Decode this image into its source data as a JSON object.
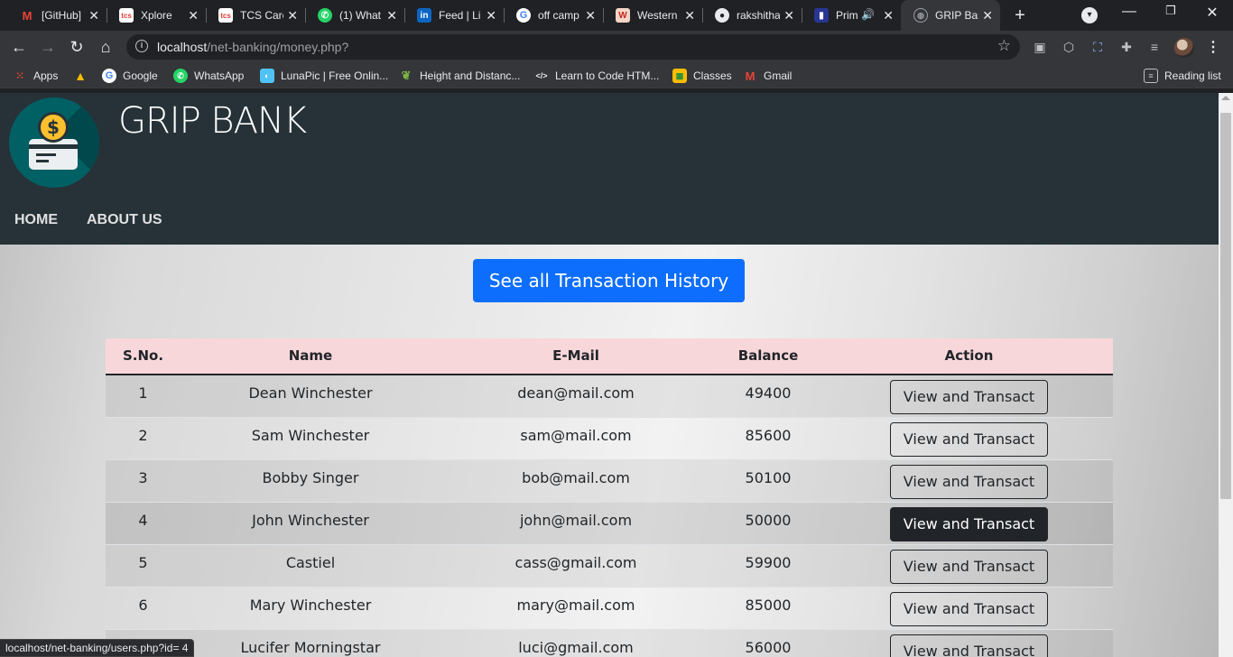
{
  "browser": {
    "tabs": [
      {
        "title": "[GitHub]",
        "icon": "gmail-icon",
        "color": "#ea4335"
      },
      {
        "title": "Xplore",
        "icon": "tcs-icon",
        "color": "#e53935"
      },
      {
        "title": "TCS Care",
        "icon": "tcs-icon",
        "color": "#e53935"
      },
      {
        "title": "(1) What",
        "icon": "whatsapp-icon",
        "color": "#25d366"
      },
      {
        "title": "Feed | Li",
        "icon": "linkedin-icon",
        "color": "#0a66c2"
      },
      {
        "title": "off camp",
        "icon": "google-icon",
        "color": "#4285f4"
      },
      {
        "title": "Western",
        "icon": "western-icon",
        "color": "#c62828"
      },
      {
        "title": "rakshitha",
        "icon": "github-icon",
        "color": "#e8eaed"
      },
      {
        "title": "Prim",
        "icon": "prime-icon",
        "color": "#283593"
      },
      {
        "title": "GRIP Ban",
        "icon": "globe-icon",
        "color": "#9aa0a6"
      }
    ],
    "address": {
      "host": "localhost",
      "path": "/net-banking/money.php?"
    },
    "bookmarks": [
      {
        "label": "Apps",
        "icon": "apps-grid-icon"
      },
      {
        "label": "",
        "icon": "google-drive-icon"
      },
      {
        "label": "Google",
        "icon": "google-icon"
      },
      {
        "label": "WhatsApp",
        "icon": "whatsapp-icon"
      },
      {
        "label": "LunaPic | Free Onlin...",
        "icon": "lunapic-icon"
      },
      {
        "label": "Height and Distanc...",
        "icon": "leaf-icon"
      },
      {
        "label": "Learn to Code HTM...",
        "icon": "code-icon"
      },
      {
        "label": "Classes",
        "icon": "classroom-icon"
      },
      {
        "label": "Gmail",
        "icon": "gmail-icon"
      }
    ],
    "reading_list": "Reading list",
    "status_url": "localhost/net-banking/users.php?id= 4"
  },
  "site": {
    "brand": "GRIP BANK",
    "nav": [
      "HOME",
      "ABOUT US"
    ],
    "history_button": "See all Transaction History",
    "table": {
      "headers": [
        "S.No.",
        "Name",
        "E-Mail",
        "Balance",
        "Action"
      ],
      "action_label": "View and Transact",
      "rows": [
        {
          "sno": "1",
          "name": "Dean Winchester",
          "email": "dean@mail.com",
          "balance": "49400"
        },
        {
          "sno": "2",
          "name": "Sam Winchester",
          "email": "sam@mail.com",
          "balance": "85600"
        },
        {
          "sno": "3",
          "name": "Bobby Singer",
          "email": "bob@mail.com",
          "balance": "50100"
        },
        {
          "sno": "4",
          "name": "John Winchester",
          "email": "john@mail.com",
          "balance": "50000"
        },
        {
          "sno": "5",
          "name": "Castiel",
          "email": "cass@gmail.com",
          "balance": "59900"
        },
        {
          "sno": "6",
          "name": "Mary Winchester",
          "email": "mary@mail.com",
          "balance": "85000"
        },
        {
          "sno": "7",
          "name": "Lucifer Morningstar",
          "email": "luci@gmail.com",
          "balance": "56000"
        }
      ]
    },
    "colors": {
      "header_bg": "#263238",
      "logo_bg": "#006064",
      "primary": "#0d6efd",
      "thead_bg": "#f8d7da",
      "dark": "#212529"
    }
  }
}
